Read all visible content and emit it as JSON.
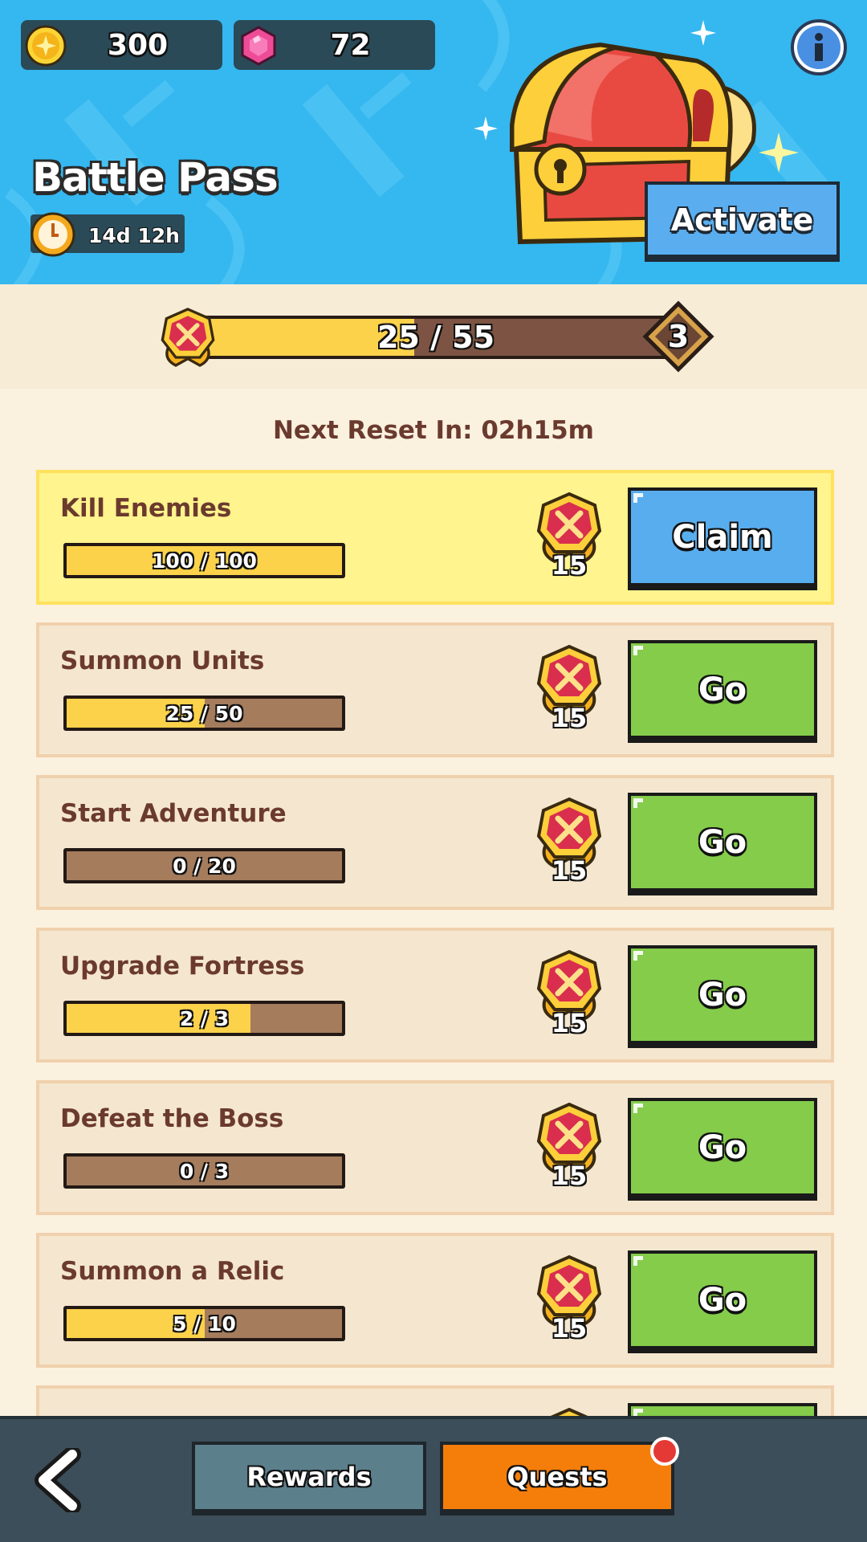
{
  "currency": {
    "gold": {
      "value": "300",
      "icon": "gold-coin-icon"
    },
    "gems": {
      "value": "72",
      "icon": "pink-gem-icon"
    }
  },
  "header": {
    "title": "Battle Pass",
    "timer": "14d 12h",
    "activate_label": "Activate",
    "info_icon": "info-icon"
  },
  "level": {
    "progress_label": "25 / 55",
    "current": 25,
    "max": 55,
    "next_level": "3"
  },
  "reset_text": "Next Reset In: 02h15m",
  "quests": [
    {
      "name": "Kill Enemies",
      "progress_label": "100 / 100",
      "progress": 1.0,
      "points": "15",
      "button": "Claim",
      "state": "claim"
    },
    {
      "name": "Summon Units",
      "progress_label": "25 / 50",
      "progress": 0.5,
      "points": "15",
      "button": "Go",
      "state": "go"
    },
    {
      "name": "Start Adventure",
      "progress_label": "0 / 20",
      "progress": 0.0,
      "points": "15",
      "button": "Go",
      "state": "go"
    },
    {
      "name": "Upgrade Fortress",
      "progress_label": "2 / 3",
      "progress": 0.667,
      "points": "15",
      "button": "Go",
      "state": "go"
    },
    {
      "name": "Defeat the Boss",
      "progress_label": "0 / 3",
      "progress": 0.0,
      "points": "15",
      "button": "Go",
      "state": "go"
    },
    {
      "name": "Summon a Relic",
      "progress_label": "5 / 10",
      "progress": 0.5,
      "points": "15",
      "button": "Go",
      "state": "go"
    },
    {
      "name": "",
      "progress_label": "",
      "progress": 0.0,
      "points": "",
      "button": "",
      "state": "go"
    }
  ],
  "nav": {
    "rewards_label": "Rewards",
    "quests_label": "Quests",
    "back_icon": "back-arrow-icon"
  },
  "colors": {
    "header_bg": "#35b7ef",
    "go_button": "#84cc4a",
    "claim_button": "#58adee",
    "active_tab": "#f57e0b",
    "bar_fill": "#fbd24a"
  }
}
